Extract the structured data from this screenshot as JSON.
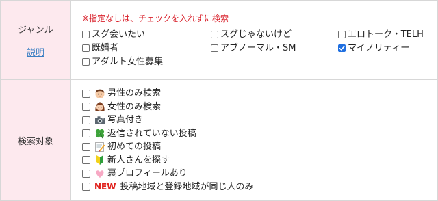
{
  "genre": {
    "label": "ジャンル",
    "help_link": "説明",
    "note": "※指定なしは、チェックを入れずに検索",
    "options": [
      {
        "label": "スグ会いたい",
        "checked": false
      },
      {
        "label": "スグじゃないけど",
        "checked": false
      },
      {
        "label": "エロトーク・TELH",
        "checked": false
      },
      {
        "label": "既婚者",
        "checked": false
      },
      {
        "label": "アブノーマル・SM",
        "checked": false
      },
      {
        "label": "マイノリティー",
        "checked": true
      },
      {
        "label": "アダルト女性募集",
        "checked": false
      }
    ]
  },
  "target": {
    "label": "検索対象",
    "options": [
      {
        "label": "男性のみ検索",
        "icon": "man-face-icon",
        "checked": false
      },
      {
        "label": "女性のみ検索",
        "icon": "woman-face-icon",
        "checked": false
      },
      {
        "label": "写真付き",
        "icon": "camera-icon",
        "checked": false
      },
      {
        "label": "返信されていない投稿",
        "icon": "four-leaf-clover-icon",
        "checked": false
      },
      {
        "label": "初めての投稿",
        "icon": "memo-icon",
        "checked": false
      },
      {
        "label": "新人さんを探す",
        "icon": "beginner-mark-icon",
        "checked": false
      },
      {
        "label": "裏プロフィールあり",
        "icon": "heart-icon",
        "checked": false
      },
      {
        "label": "投稿地域と登録地域が同じ人のみ",
        "icon": "new-badge",
        "badge_text": "NEW",
        "checked": false
      }
    ]
  },
  "colors": {
    "label_bg": "#fde9ee",
    "note_red": "#d9232d",
    "link_blue": "#3a7fc3",
    "check_blue": "#1f6fe0"
  }
}
